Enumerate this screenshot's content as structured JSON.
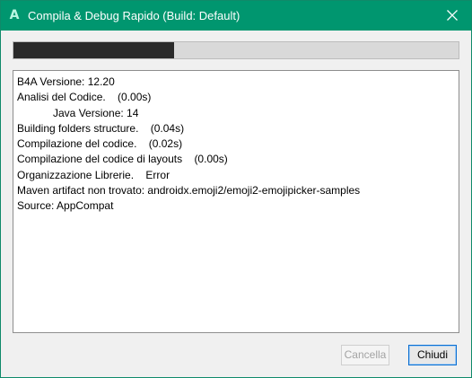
{
  "window": {
    "title": "Compila & Debug Rapido (Build: Default)",
    "app_icon_glyph": "A",
    "accent_color": "#00966f"
  },
  "progress": {
    "fraction": 0.36
  },
  "log": {
    "lines": [
      "B4A Versione: 12.20",
      "Analisi del Codice.    (0.00s)",
      "            Java Versione: 14",
      "Building folders structure.    (0.04s)",
      "Compilazione del codice.    (0.02s)",
      "Compilazione del codice di layouts    (0.00s)",
      "Organizzazione Librerie.    Error",
      "Maven artifact non trovato: androidx.emoji2/emoji2-emojipicker-samples",
      "Source: AppCompat"
    ]
  },
  "buttons": {
    "cancel_label": "Cancella",
    "close_label": "Chiudi"
  },
  "icons": {
    "app": "b4a-app-icon",
    "close": "close-icon"
  }
}
